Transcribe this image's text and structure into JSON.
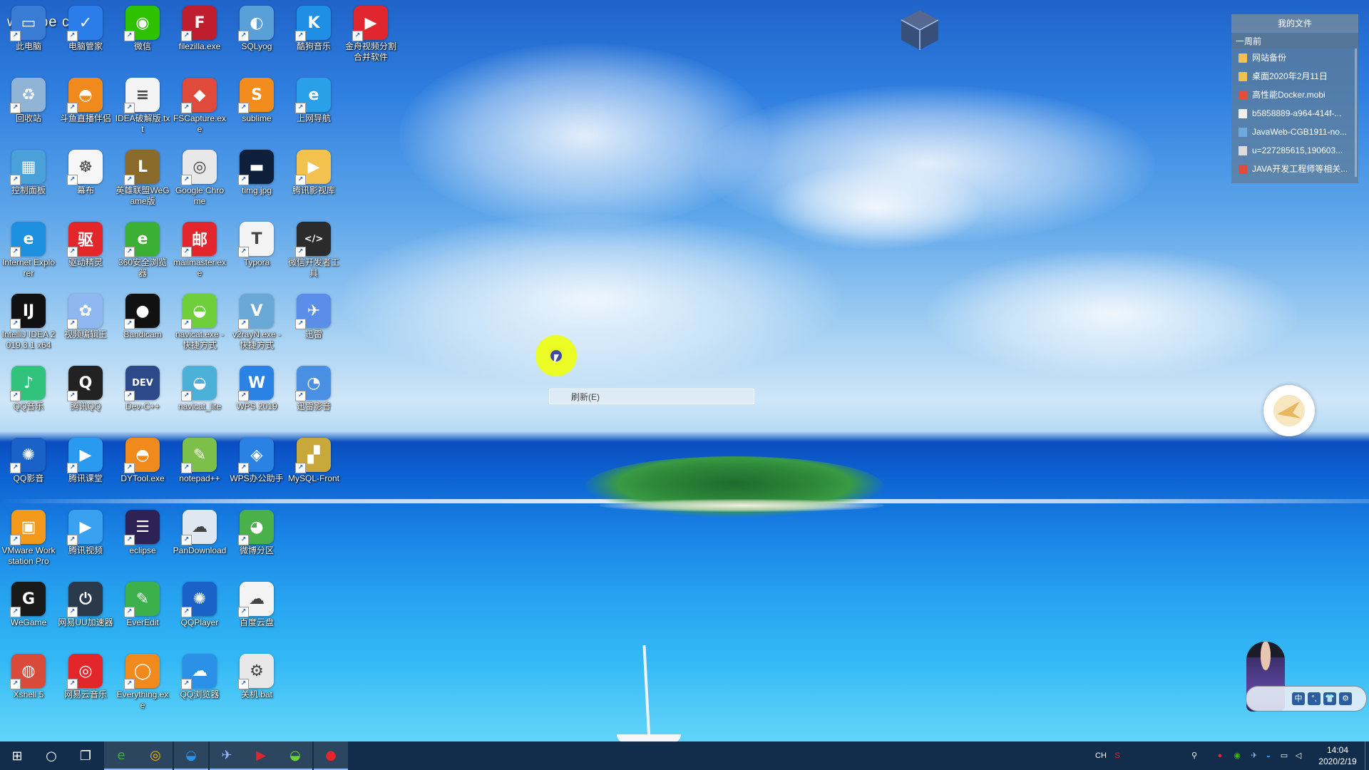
{
  "desktop": {
    "overlay_text": "wa ape chd",
    "icons": [
      {
        "label": "此电脑",
        "icon": "computer-icon",
        "color": "#3a7bd5",
        "glyph": "▭"
      },
      {
        "label": "电脑管家",
        "icon": "shield-icon",
        "color": "#2b7de9",
        "glyph": "✓"
      },
      {
        "label": "微信",
        "icon": "wechat-icon",
        "color": "#2dc100",
        "glyph": "◉"
      },
      {
        "label": "filezilla.exe",
        "icon": "filezilla-icon",
        "color": "#bf1e2e",
        "glyph": "F"
      },
      {
        "label": "SQLyog",
        "icon": "dolphin-icon",
        "color": "#5aa0d8",
        "glyph": "◐"
      },
      {
        "label": "酷狗音乐",
        "icon": "kugou-icon",
        "color": "#1f8fe5",
        "glyph": "K"
      },
      {
        "label": "金舟视频分割合并软件",
        "icon": "video-split-icon",
        "color": "#e0262e",
        "glyph": "▶"
      },
      {
        "label": "回收站",
        "icon": "recycle-bin-icon",
        "color": "#8fb4d6",
        "glyph": "♻"
      },
      {
        "label": "斗鱼直播伴侣",
        "icon": "douyu-icon",
        "color": "#f08a1c",
        "glyph": "◓"
      },
      {
        "label": "IDEA破解版.txt",
        "icon": "text-file-icon",
        "color": "#f4f4f4",
        "glyph": "≡"
      },
      {
        "label": "FSCapture.exe",
        "icon": "fscapture-icon",
        "color": "#e04a3a",
        "glyph": "◆"
      },
      {
        "label": "sublime",
        "icon": "sublime-icon",
        "color": "#f28c1c",
        "glyph": "S"
      },
      {
        "label": "上网导航",
        "icon": "ie-nav-icon",
        "color": "#2aa0e8",
        "glyph": "e"
      },
      {
        "label": "控制面板",
        "icon": "control-panel-icon",
        "color": "#4aa0d8",
        "glyph": "▦"
      },
      {
        "label": "幕布",
        "icon": "mubu-icon",
        "color": "#f7f7f7",
        "glyph": "☸"
      },
      {
        "label": "英雄联盟WeGame版",
        "icon": "lol-icon",
        "color": "#8a6a2a",
        "glyph": "L"
      },
      {
        "label": "Google Chrome",
        "icon": "chrome-icon",
        "color": "#e8e8e8",
        "glyph": "◎"
      },
      {
        "label": "timg.jpg",
        "icon": "image-file-icon",
        "color": "#0d1f3a",
        "glyph": "▬"
      },
      {
        "label": "腾讯影视库",
        "icon": "folder-video-icon",
        "color": "#f2c14e",
        "glyph": "▶"
      },
      {
        "label": "Internet Explorer",
        "icon": "ie-icon",
        "color": "#1e90e0",
        "glyph": "e"
      },
      {
        "label": "驱动精灵",
        "icon": "driver-icon",
        "color": "#e2262a",
        "glyph": "驱"
      },
      {
        "label": "360安全浏览器",
        "icon": "360-browser-icon",
        "color": "#3cb034",
        "glyph": "e"
      },
      {
        "label": "mailmaster.exe",
        "icon": "mail-icon",
        "color": "#e3262e",
        "glyph": "邮"
      },
      {
        "label": "Typora",
        "icon": "typora-icon",
        "color": "#f4f4f4",
        "glyph": "T"
      },
      {
        "label": "微信开发者工具",
        "icon": "devtools-icon",
        "color": "#2b2b2b",
        "glyph": "</>"
      },
      {
        "label": "IntelliJ IDEA 2019.3.1 x64",
        "icon": "intellij-icon",
        "color": "#111111",
        "glyph": "IJ"
      },
      {
        "label": "视频编辑王",
        "icon": "video-edit-icon",
        "color": "#8fb8f0",
        "glyph": "✿"
      },
      {
        "label": "Bandicam",
        "icon": "bandicam-icon",
        "color": "#111111",
        "glyph": "●"
      },
      {
        "label": "navicat.exe - 快捷方式",
        "icon": "navicat-icon",
        "color": "#6fcf3a",
        "glyph": "◒"
      },
      {
        "label": "v2rayN.exe - 快捷方式",
        "icon": "v2ray-icon",
        "color": "#6aa8d8",
        "glyph": "V"
      },
      {
        "label": "迅雷",
        "icon": "thunder-icon",
        "color": "#5a8ee8",
        "glyph": "✈"
      },
      {
        "label": "QQ音乐",
        "icon": "qq-music-icon",
        "color": "#31c27c",
        "glyph": "♪"
      },
      {
        "label": "腾讯QQ",
        "icon": "qq-icon",
        "color": "#222222",
        "glyph": "Q"
      },
      {
        "label": "Dev-C++",
        "icon": "devcpp-icon",
        "color": "#2c4a8a",
        "glyph": "DEV"
      },
      {
        "label": "navicat_lite",
        "icon": "navicat-lite-icon",
        "color": "#4ab0d8",
        "glyph": "◒"
      },
      {
        "label": "WPS 2019",
        "icon": "wps-icon",
        "color": "#2a82e4",
        "glyph": "W"
      },
      {
        "label": "迅雷影音",
        "icon": "thunder-player-icon",
        "color": "#4a90e2",
        "glyph": "◔"
      },
      {
        "label": "QQ影音",
        "icon": "qq-player-icon",
        "color": "#1a62c8",
        "glyph": "✺"
      },
      {
        "label": "腾讯课堂",
        "icon": "tencent-class-icon",
        "color": "#2a9af0",
        "glyph": "▶"
      },
      {
        "label": "DYTool.exe",
        "icon": "dytool-icon",
        "color": "#f08a1c",
        "glyph": "◓"
      },
      {
        "label": "notepad++",
        "icon": "notepad-icon",
        "color": "#7cc04a",
        "glyph": "✎"
      },
      {
        "label": "WPS办公助手",
        "icon": "wps-helper-icon",
        "color": "#2a82e4",
        "glyph": "◈"
      },
      {
        "label": "MySQL-Front",
        "icon": "mysql-front-icon",
        "color": "#c8a83a",
        "glyph": "▞"
      },
      {
        "label": "VMware Workstation Pro",
        "icon": "vmware-icon",
        "color": "#f39a1c",
        "glyph": "▣"
      },
      {
        "label": "腾讯视频",
        "icon": "tencent-video-icon",
        "color": "#3aa0f0",
        "glyph": "▶"
      },
      {
        "label": "eclipse",
        "icon": "eclipse-icon",
        "color": "#2c2255",
        "glyph": "☰"
      },
      {
        "label": "PanDownload",
        "icon": "pandownload-icon",
        "color": "#dfe8f0",
        "glyph": "☁"
      },
      {
        "label": "微博分区",
        "icon": "weibo-partition-icon",
        "color": "#4ab04a",
        "glyph": "◕"
      },
      {
        "label": "WeGame",
        "icon": "wegame-icon",
        "color": "#1a1a1a",
        "glyph": "G"
      },
      {
        "label": "网易UU加速器",
        "icon": "uu-icon",
        "color": "#2a3a4a",
        "glyph": "⏻"
      },
      {
        "label": "EverEdit",
        "icon": "everedit-icon",
        "color": "#3cb04a",
        "glyph": "✎"
      },
      {
        "label": "QQPlayer",
        "icon": "qqplayer-icon",
        "color": "#1a62c8",
        "glyph": "✺"
      },
      {
        "label": "百度云盘",
        "icon": "baidu-cloud-icon",
        "color": "#f4f4f4",
        "glyph": "☁"
      },
      {
        "label": "Xshell 5",
        "icon": "xshell-icon",
        "color": "#d84a3a",
        "glyph": "◍"
      },
      {
        "label": "网易云音乐",
        "icon": "netease-music-icon",
        "color": "#e2262a",
        "glyph": "◎"
      },
      {
        "label": "Everything.exe",
        "icon": "everything-icon",
        "color": "#f08a1c",
        "glyph": "◯"
      },
      {
        "label": "QQ浏览器",
        "icon": "qq-browser-icon",
        "color": "#2a90e8",
        "glyph": "☁"
      },
      {
        "label": "关机.bat",
        "icon": "bat-file-icon",
        "color": "#e8e8e8",
        "glyph": "⚙"
      }
    ]
  },
  "file_panel": {
    "title": "我的文件",
    "group": "一周前",
    "items": [
      {
        "name": "网站备份",
        "type": "folder"
      },
      {
        "name": "桌面2020年2月11日",
        "type": "folder"
      },
      {
        "name": "高性能Docker.mobi",
        "type": "pdf"
      },
      {
        "name": "b5858889-a964-414f-...",
        "type": "doc"
      },
      {
        "name": "JavaWeb-CGB1911-no...",
        "type": "img"
      },
      {
        "name": "u=227285615,190603...",
        "type": "txt"
      },
      {
        "name": "JAVA开发工程师等相关...",
        "type": "pdf"
      }
    ]
  },
  "context_menu": {
    "refresh_label": "刷新(E)"
  },
  "ime": {
    "keys": [
      "中",
      "°,",
      "👕",
      "⚙"
    ]
  },
  "taskbar": {
    "apps": [
      {
        "name": "start-button",
        "icon": "windows-icon",
        "glyph": "⊞",
        "color": "#ffffff"
      },
      {
        "name": "search-button",
        "icon": "search-circle-icon",
        "glyph": "○",
        "color": "#ffffff"
      },
      {
        "name": "task-view-button",
        "icon": "task-view-icon",
        "glyph": "❐",
        "color": "#ffffff"
      },
      {
        "name": "taskbar-360-browser",
        "icon": "360-browser-icon",
        "glyph": "e",
        "color": "#3cb034"
      },
      {
        "name": "taskbar-chrome",
        "icon": "chrome-icon",
        "glyph": "◎",
        "color": "#f2b40c"
      },
      {
        "name": "taskbar-qq-browser",
        "icon": "qq-browser-icon",
        "glyph": "◒",
        "color": "#2a90e8"
      },
      {
        "name": "taskbar-thunder",
        "icon": "thunder-icon",
        "glyph": "✈",
        "color": "#8fb8ff"
      },
      {
        "name": "taskbar-video-split",
        "icon": "video-split-icon",
        "glyph": "▶",
        "color": "#e0262e"
      },
      {
        "name": "taskbar-navicat",
        "icon": "navicat-icon",
        "glyph": "◒",
        "color": "#6fcf3a"
      },
      {
        "name": "taskbar-bandicam",
        "icon": "bandicam-icon",
        "glyph": "●",
        "color": "#e2262a"
      }
    ],
    "tray": {
      "lang_label": "CH",
      "icons": [
        {
          "name": "sougou-ime-icon",
          "glyph": "S",
          "color": "#e2262a"
        },
        {
          "name": "people-icon",
          "glyph": "⚲",
          "color": "#ffffff"
        },
        {
          "name": "record-icon",
          "glyph": "●",
          "color": "#e2262a"
        },
        {
          "name": "wechat-tray-icon",
          "glyph": "◉",
          "color": "#2dc100"
        },
        {
          "name": "thunder-tray-icon",
          "glyph": "✈",
          "color": "#8fb8ff"
        },
        {
          "name": "qq-tray-icon",
          "glyph": "◒",
          "color": "#2a90e8"
        },
        {
          "name": "network-icon",
          "glyph": "▭",
          "color": "#ffffff"
        },
        {
          "name": "volume-icon",
          "glyph": "◁",
          "color": "#ffffff"
        },
        {
          "name": "chevron-up-icon",
          "glyph": "⌃",
          "color": "#ffffff"
        }
      ]
    },
    "clock_time": "14:04",
    "clock_date": "2020/2/19"
  }
}
